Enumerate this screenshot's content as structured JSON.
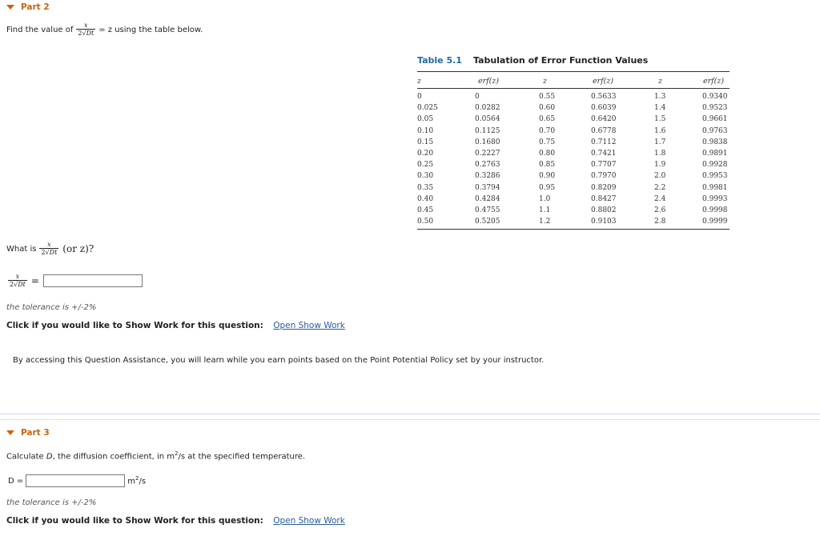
{
  "part2": {
    "heading": "Part 2",
    "prompt_before": "Find the value of",
    "prompt_after": "= z using the table below.",
    "fraction": {
      "numerator": "x",
      "coef": "2",
      "radicand": "Dt"
    },
    "question_prefix": "What is",
    "question_suffix": "(or z)?",
    "answer_eq": "=",
    "answer_value": "",
    "tolerance": "the tolerance is +/-2%",
    "show_work_label": "Click if you would like to Show Work for this question:",
    "show_work_link": "Open Show Work"
  },
  "assist_text": "By accessing this Question Assistance, you will learn while you earn points based on the Point Potential Policy set by your instructor.",
  "table": {
    "label": "Table 5.1",
    "title": "Tabulation of Error Function Values",
    "headers": [
      "z",
      "erf(z)",
      "z",
      "erf(z)",
      "z",
      "erf(z)"
    ],
    "col1_z": [
      "0",
      "0.025",
      "0.05",
      "0.10",
      "0.15",
      "0.20",
      "0.25",
      "0.30",
      "0.35",
      "0.40",
      "0.45",
      "0.50"
    ],
    "col1_erf": [
      "0",
      "0.0282",
      "0.0564",
      "0.1125",
      "0.1680",
      "0.2227",
      "0.2763",
      "0.3286",
      "0.3794",
      "0.4284",
      "0.4755",
      "0.5205"
    ],
    "col2_z": [
      "0.55",
      "0.60",
      "0.65",
      "0.70",
      "0.75",
      "0.80",
      "0.85",
      "0.90",
      "0.95",
      "1.0",
      "1.1",
      "1.2"
    ],
    "col2_erf": [
      "0.5633",
      "0.6039",
      "0.6420",
      "0.6778",
      "0.7112",
      "0.7421",
      "0.7707",
      "0.7970",
      "0.8209",
      "0.8427",
      "0.8802",
      "0.9103"
    ],
    "col3_z": [
      "1.3",
      "1.4",
      "1.5",
      "1.6",
      "1.7",
      "1.8",
      "1.9",
      "2.0",
      "2.2",
      "2.4",
      "2.6",
      "2.8"
    ],
    "col3_erf": [
      "0.9340",
      "0.9523",
      "0.9661",
      "0.9763",
      "0.9838",
      "0.9891",
      "0.9928",
      "0.9953",
      "0.9981",
      "0.9993",
      "0.9998",
      "0.9999"
    ]
  },
  "part3": {
    "heading": "Part 3",
    "prompt_a": "Calculate ",
    "prompt_var": "D",
    "prompt_b": ", the diffusion coefficient, in m",
    "prompt_sup": "2",
    "prompt_c": "/s at the specified temperature.",
    "input_label": "D =",
    "input_value": "",
    "unit_base": "m",
    "unit_sup": "2",
    "unit_tail": "/s",
    "tolerance": "the tolerance is +/-2%",
    "show_work_label": "Click if you would like to Show Work for this question:",
    "show_work_link": "Open Show Work"
  }
}
